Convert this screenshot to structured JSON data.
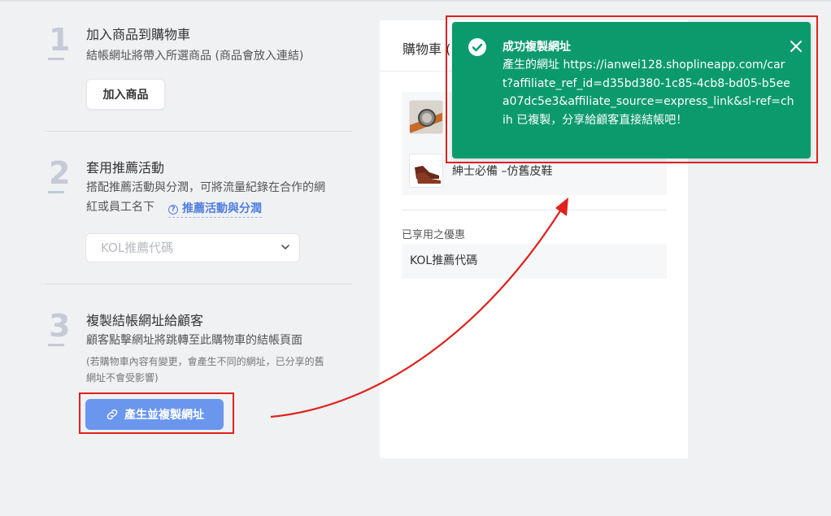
{
  "steps": [
    {
      "number": "1",
      "title": "加入商品到購物車",
      "description": "結帳網址將帶入所選商品 (商品會放入連結)",
      "button_label": "加入商品"
    },
    {
      "number": "2",
      "title": "套用推薦活動",
      "description_line1": "搭配推薦活動與分潤，可將流量紀錄在合作的網",
      "description_line2": "紅或員工名下",
      "help_link": "推薦活動與分潤",
      "select_placeholder": "KOL推薦代碼"
    },
    {
      "number": "3",
      "title": "複製結帳網址給顧客",
      "description": "顧客點擊網址將跳轉至此購物車的結帳頁面",
      "note_line1": "(若購物車內容有變更，會產生不同的網址，已分享的舊",
      "note_line2": "網址不會受影響)",
      "button_label": "產生並複製網址"
    }
  ],
  "cart": {
    "title": "購物車 (",
    "items": [
      {
        "name": ""
      },
      {
        "name": "紳士必備 –仿舊皮鞋"
      }
    ],
    "applied_label": "已享用之優惠",
    "applied_value": "KOL推薦代碼"
  },
  "toast": {
    "title": "成功複製網址",
    "body": "產生的網址 https://ianwei128.shoplineapp.com/cart?affiliate_ref_id=d35bd380-1c85-4cb8-bd05-b5eea07dc5e3&affiliate_source=express_link&sl-ref=chih 已複製，分享給顧客直接結帳吧！",
    "background": "#0b9a6c"
  },
  "colors": {
    "accent": "#6a96ee",
    "link": "#4f7fe0",
    "highlight": "#e0211b"
  }
}
